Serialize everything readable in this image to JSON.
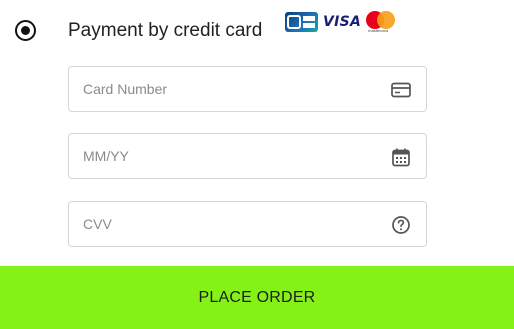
{
  "payment": {
    "option_label": "Payment by credit card",
    "selected": true,
    "logos": {
      "cb": "CB",
      "visa": "VISA",
      "mastercard": "mastercard"
    }
  },
  "fields": {
    "card_number": {
      "placeholder": "Card Number",
      "value": "",
      "icon": "credit-card-icon"
    },
    "expiry": {
      "placeholder": "MM/YY",
      "value": "",
      "icon": "calendar-icon"
    },
    "cvv": {
      "placeholder": "CVV",
      "value": "",
      "icon": "question-circle-icon"
    }
  },
  "actions": {
    "place_order_label": "PLACE ORDER"
  },
  "colors": {
    "button_bg": "#84f217",
    "border": "#d6d6d6",
    "placeholder": "#8a8a8a"
  }
}
